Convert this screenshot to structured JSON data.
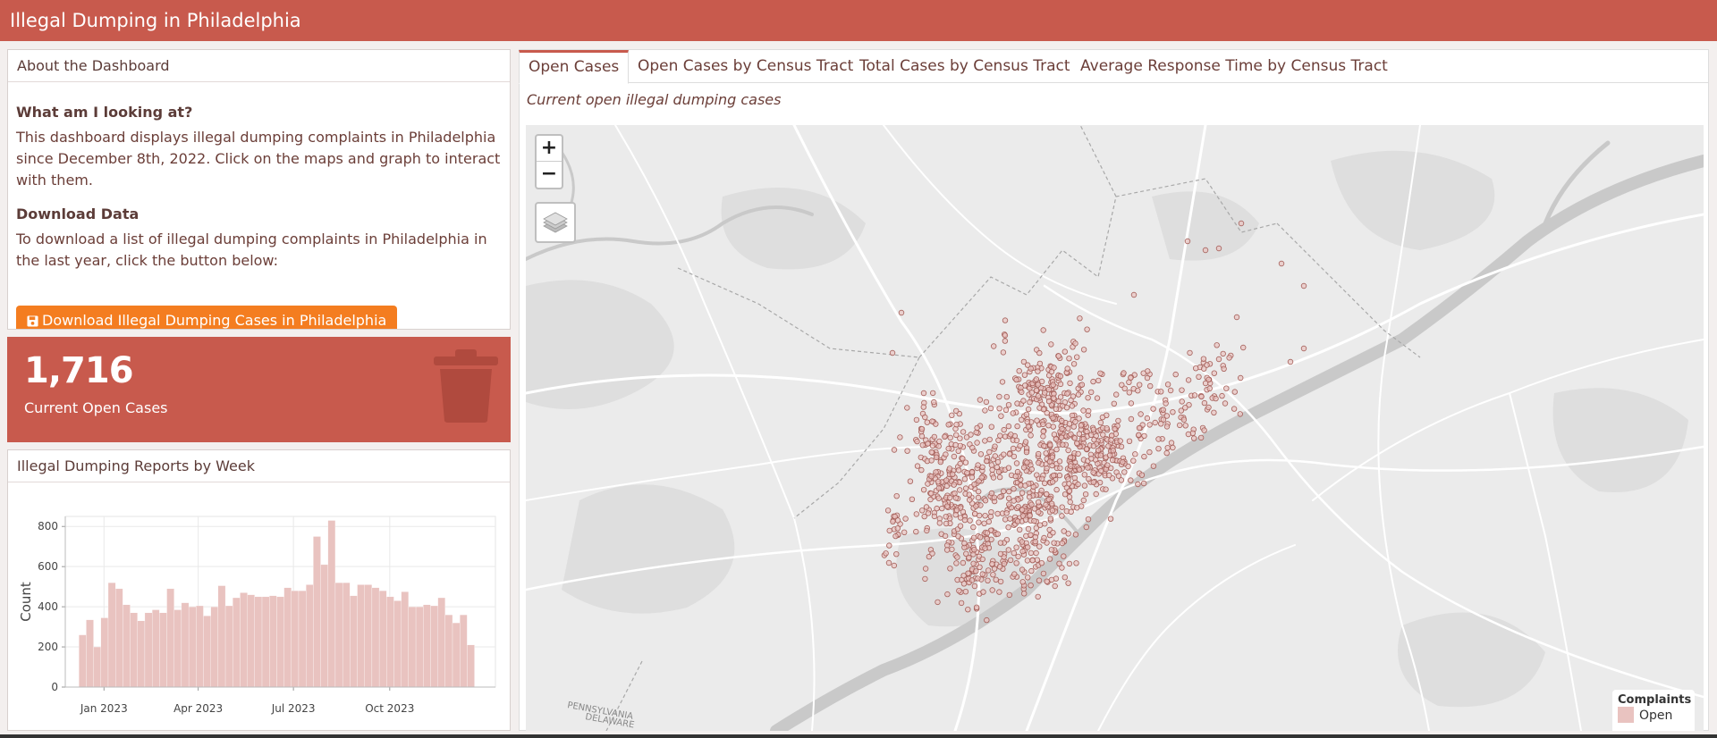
{
  "header": {
    "title": "Illegal Dumping in Philadelphia"
  },
  "about": {
    "title": "About the Dashboard",
    "q1": "What am I looking at?",
    "p1": "This dashboard displays illegal dumping complaints in Philadelphia since December 8th, 2022. Click on the maps and graph to interact with them.",
    "q2": "Download Data",
    "p2": "To download a list of illegal dumping complaints in Philadelphia in the last year, click the button below:",
    "download_label": "Download Illegal Dumping Cases in Philadelphia"
  },
  "value_box": {
    "value": "1,716",
    "caption": "Current Open Cases",
    "icon": "trash-icon"
  },
  "weekly": {
    "title": "Illegal Dumping Reports by Week"
  },
  "tabs": [
    {
      "label": "Open Cases",
      "active": true
    },
    {
      "label": "Open Cases by Census Tract",
      "active": false
    },
    {
      "label": "Total Cases by Census Tract",
      "active": false
    },
    {
      "label": "Average Response Time by Census Tract",
      "active": false
    }
  ],
  "map": {
    "subtitle": "Current open illegal dumping cases",
    "zoom_in": "+",
    "zoom_out": "−",
    "legend_title": "Complaints",
    "legend_item": "Open",
    "place_label_1": "PENNSYLVANIA",
    "place_label_2": "DELAWARE"
  },
  "colors": {
    "header": "#c85a4d",
    "accent": "#c85a4d",
    "button": "#f47d20",
    "bars": "#e9c3c0",
    "points": "#a5605a"
  },
  "chart_data": {
    "type": "bar",
    "title": "",
    "xlabel": "",
    "ylabel": "Count",
    "ylim": [
      0,
      850
    ],
    "yticks": [
      0,
      200,
      400,
      600,
      800
    ],
    "xtick_labels": [
      "Jan 2023",
      "Apr 2023",
      "Jul 2023",
      "Oct 2023"
    ],
    "xtick_dates": [
      "2023-01-01",
      "2023-04-01",
      "2023-07-01",
      "2023-10-01"
    ],
    "x_range": [
      "2022-11-25",
      "2024-01-10"
    ],
    "first_week": "2022-12-08",
    "values": [
      260,
      335,
      200,
      345,
      520,
      490,
      410,
      370,
      330,
      370,
      385,
      370,
      490,
      385,
      420,
      400,
      405,
      355,
      400,
      505,
      405,
      445,
      470,
      460,
      450,
      450,
      455,
      450,
      495,
      480,
      480,
      510,
      750,
      610,
      830,
      520,
      520,
      455,
      510,
      510,
      495,
      480,
      450,
      430,
      475,
      400,
      400,
      410,
      405,
      445,
      360,
      320,
      360,
      210
    ]
  }
}
